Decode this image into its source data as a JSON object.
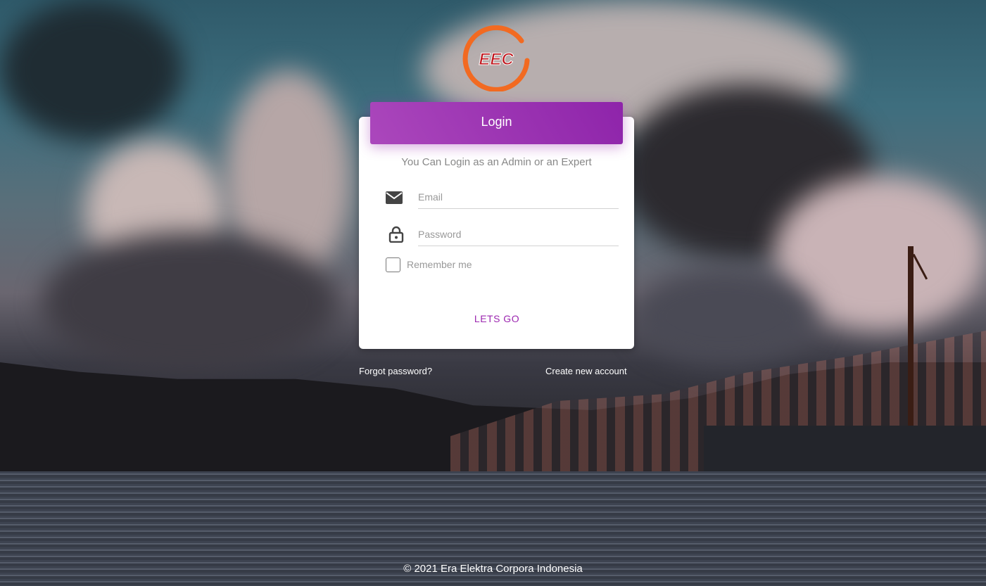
{
  "brand": {
    "logo_text": "EEC",
    "ring_color": "#f26a21",
    "text_color": "#c0171e"
  },
  "login": {
    "title": "Login",
    "subtitle": "You Can Login as an Admin or an Expert",
    "email_placeholder": "Email",
    "password_placeholder": "Password",
    "remember_label": "Remember me",
    "remember_checked": false,
    "submit_label": "LETS GO"
  },
  "links": {
    "forgot": "Forgot password?",
    "create": "Create new account"
  },
  "footer": {
    "text": "© 2021 Era Elektra Corpora Indonesia"
  },
  "colors": {
    "accent": "#9c27b0",
    "header_gradient_start": "#ab47bc",
    "header_gradient_end": "#8e24aa"
  },
  "icons": {
    "email": "envelope-icon",
    "password": "lock-icon"
  }
}
